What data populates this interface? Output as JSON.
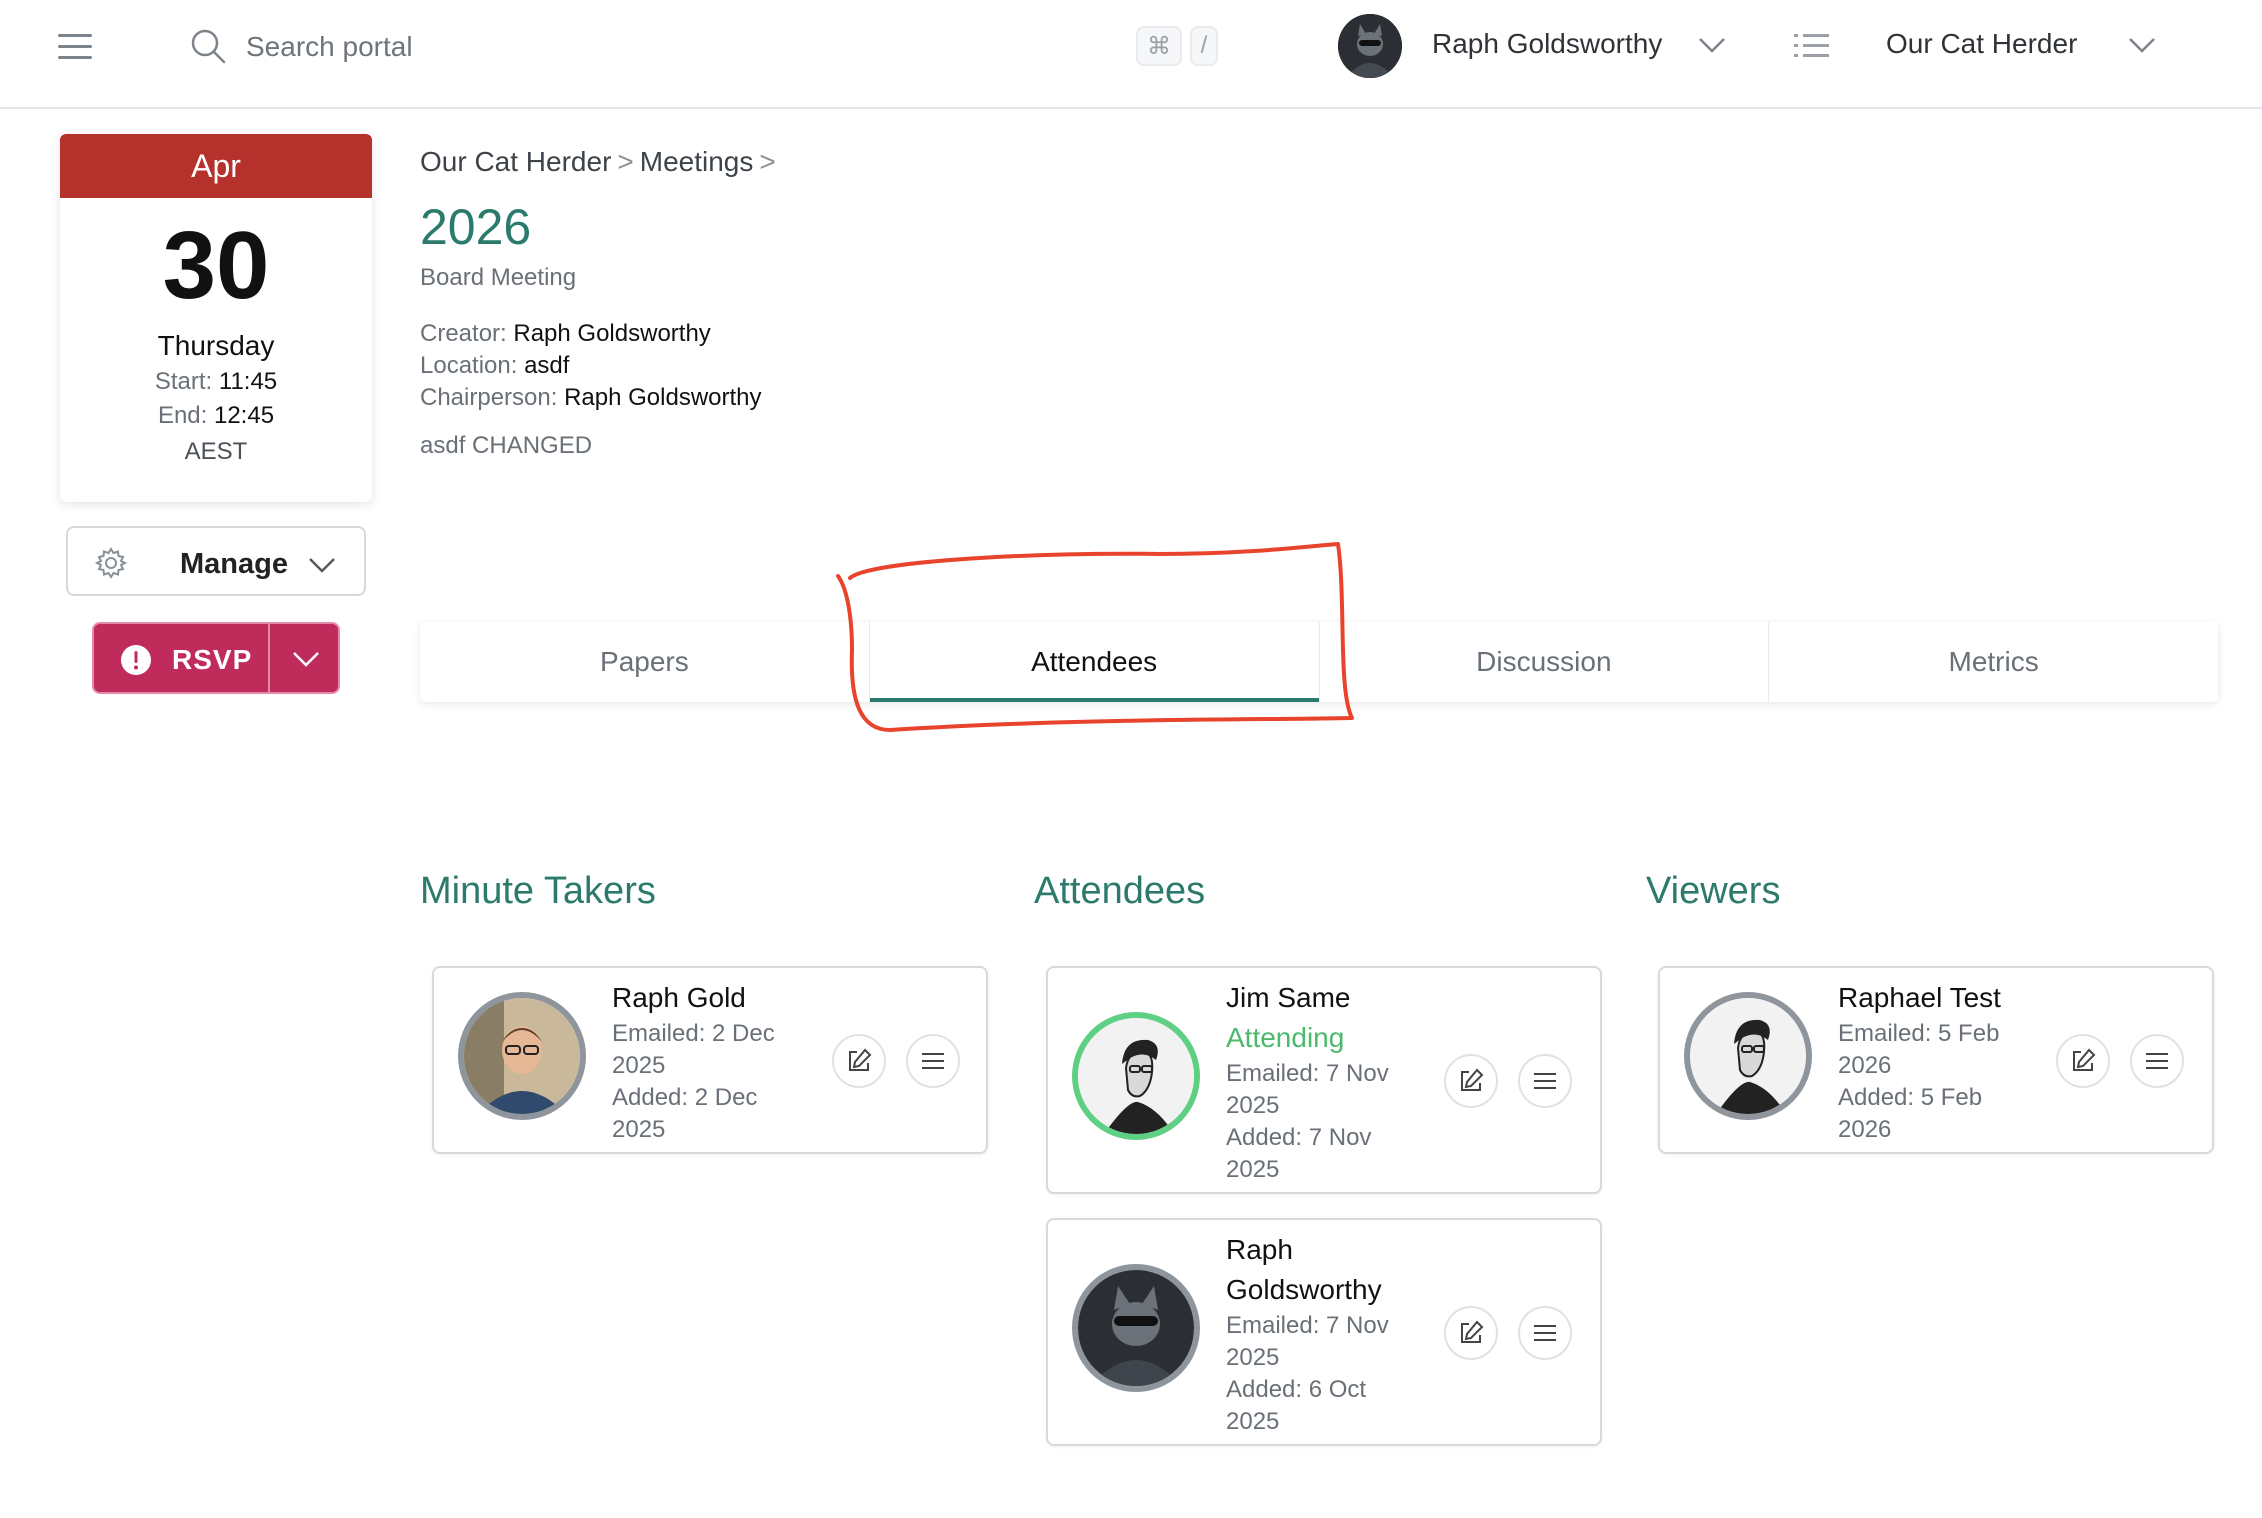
{
  "topbar": {
    "search_placeholder": "Search portal",
    "shortcut_cmd": "⌘",
    "shortcut_key": "/",
    "user_name": "Raph Goldsworthy",
    "org_name": "Our Cat Herder"
  },
  "calendar": {
    "month": "Apr",
    "day": "30",
    "weekday": "Thursday",
    "start_label": "Start:",
    "start_time": "11:45",
    "end_label": "End:",
    "end_time": "12:45",
    "timezone": "AEST"
  },
  "actions": {
    "manage_label": "Manage",
    "rsvp_label": "RSVP"
  },
  "breadcrumb": {
    "items": [
      "Our Cat Herder",
      "Meetings"
    ],
    "separator": ">"
  },
  "meeting": {
    "title": "2026",
    "type": "Board Meeting",
    "creator_label": "Creator:",
    "creator": "Raph Goldsworthy",
    "location_label": "Location:",
    "location": "asdf",
    "chair_label": "Chairperson:",
    "chair": "Raph Goldsworthy",
    "description": "asdf CHANGED"
  },
  "tabs": [
    {
      "label": "Papers",
      "active": false
    },
    {
      "label": "Attendees",
      "active": true
    },
    {
      "label": "Discussion",
      "active": false
    },
    {
      "label": "Metrics",
      "active": false
    }
  ],
  "sections": {
    "minute_takers": {
      "title": "Minute Takers",
      "people": [
        {
          "name": "Raph Gold",
          "emailed_1": "Emailed: 2 Dec",
          "emailed_2": "2025",
          "added_1": "Added: 2 Dec",
          "added_2": "2025"
        }
      ]
    },
    "attendees": {
      "title": "Attendees",
      "people": [
        {
          "name": "Jim Same",
          "status": "Attending",
          "emailed_1": "Emailed: 7 Nov",
          "emailed_2": "2025",
          "added_1": "Added: 7 Nov",
          "added_2": "2025"
        },
        {
          "name_1": "Raph",
          "name_2": "Goldsworthy",
          "emailed_1": "Emailed: 7 Nov",
          "emailed_2": "2025",
          "added_1": "Added: 6 Oct",
          "added_2": "2025"
        }
      ]
    },
    "viewers": {
      "title": "Viewers",
      "people": [
        {
          "name": "Raphael Test",
          "emailed_1": "Emailed: 5 Feb",
          "emailed_2": "2026",
          "added_1": "Added: 5 Feb",
          "added_2": "2026"
        }
      ]
    }
  },
  "colors": {
    "accent": "#2c7a6b",
    "calendar_header": "#b5312b",
    "rsvp": "#bf2c5c",
    "attending": "#4cba6c",
    "annotation": "#e8442d"
  }
}
